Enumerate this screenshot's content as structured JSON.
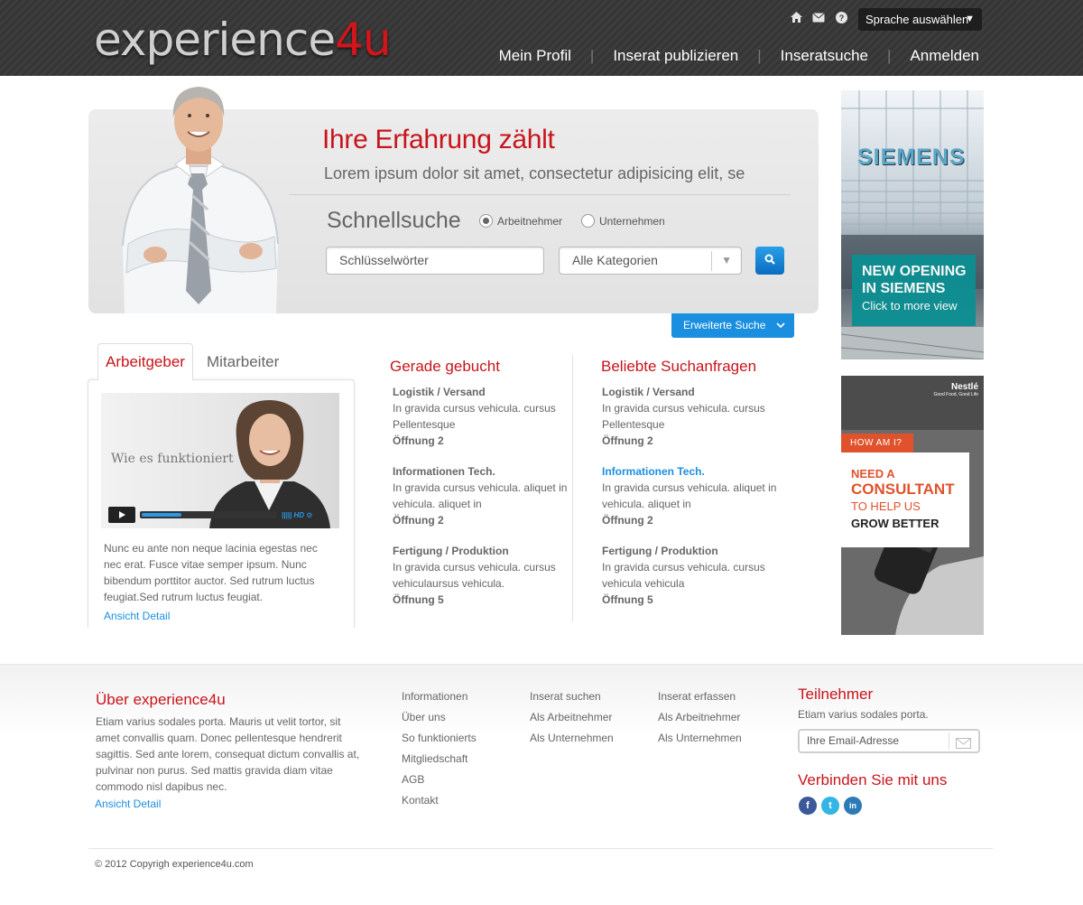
{
  "header": {
    "logo_part1": "experience",
    "logo_part2": "4u",
    "language_select": "Sprache auswählen",
    "nav": [
      "Mein Profil",
      "Inserat publizieren",
      "Inseratsuche",
      "Anmelden"
    ],
    "icons": [
      "home-icon",
      "mail-icon",
      "help-icon"
    ]
  },
  "hero": {
    "title": "Ihre Erfahrung zählt",
    "subtitle": "Lorem ipsum dolor sit amet, consectetur adipisicing elit, se",
    "quick_search_title": "Schnellsuche",
    "radio_options": [
      {
        "label": "Arbeitnehmer",
        "selected": true
      },
      {
        "label": "Unternehmen",
        "selected": false
      }
    ],
    "keywords_placeholder": "Schlüsselwörter",
    "category_select": "Alle Kategorien",
    "advanced_search": "Erweiterte Suche"
  },
  "tabs": {
    "active": "Arbeitgeber",
    "inactive": "Mitarbeiter",
    "video_label": "Wie es funktioniert",
    "video_progress": 0.3,
    "text": "Nunc eu ante non neque lacinia egestas nec nec erat. Fusce vitae semper ipsum. Nunc bibendum porttitor auctor. Sed rutrum luctus feugiat.Sed rutrum luctus feugiat.",
    "link": "Ansicht Detail"
  },
  "recent": {
    "title": "Gerade gebucht",
    "items": [
      {
        "title": "Logistik / Versand",
        "text": "In gravida cursus vehicula. cursus Pellentesque",
        "openings": "Öffnung 2"
      },
      {
        "title": "Informationen Tech.",
        "text": "In gravida cursus vehicula. aliquet in vehicula. aliquet in",
        "openings": "Öffnung 2"
      },
      {
        "title": "Fertigung / Produktion",
        "text": "In gravida cursus vehicula. cursus vehiculaursus vehicula.",
        "openings": "Öffnung  5"
      }
    ]
  },
  "popular": {
    "title": "Beliebte Suchanfragen",
    "items": [
      {
        "title": "Logistik / Versand",
        "text": "In gravida cursus vehicula. cursus Pellentesque",
        "openings": "Öffnung 2"
      },
      {
        "title": "Informationen Tech.",
        "text": "In gravida cursus vehicula. aliquet in vehicula. aliquet in",
        "openings": "Öffnung 2"
      },
      {
        "title": "Fertigung / Produktion",
        "text": "In gravida cursus vehicula. cursus vehicula vehicula",
        "openings": "Öffnung  5"
      }
    ]
  },
  "ads": {
    "ad1": {
      "brand": "SIEMENS",
      "line1": "NEW OPENING",
      "line2": "IN SIEMENS",
      "line3": "Click to more view"
    },
    "ad2": {
      "brand": "Nestlé",
      "tagline": "Good Food, Good Life",
      "badge": "HOW AM I?",
      "line1": "NEED A",
      "line2": "CONSULTANT",
      "line3": "TO HELP US",
      "line4": "GROW BETTER"
    }
  },
  "footer": {
    "about_title": "Über experience4u",
    "about_text": "Etiam varius sodales porta. Mauris ut velit tortor, sit amet convallis quam. Donec pellentesque hendrerit sagittis. Sed ante lorem, consequat dictum convallis at, pulvinar non purus. Sed mattis gravida diam vitae commodo nisl dapibus nec.",
    "about_link": "Ansicht Detail",
    "col1": [
      "Informationen",
      "Über uns",
      "So funktionierts",
      "Mitgliedschaft",
      "AGB",
      "Kontakt"
    ],
    "col2": [
      "Inserat suchen",
      "Als Arbeitnehmer",
      "Als Unternehmen"
    ],
    "col3": [
      "Inserat erfassen",
      "Als Arbeitnehmer",
      "Als Unternehmen"
    ],
    "participants_title": "Teilnehmer",
    "participants_text": "Etiam varius sodales porta.",
    "email_placeholder": "Ihre Email-Adresse",
    "connect_title": "Verbinden Sie mit uns",
    "social": [
      "f",
      "t",
      "in"
    ],
    "copyright": "© 2012 Copyrigh experience4u.com"
  },
  "colors": {
    "accent_red": "#c8141b",
    "accent_blue": "#1a8fe0",
    "header_bg": "#3a3a3a"
  }
}
